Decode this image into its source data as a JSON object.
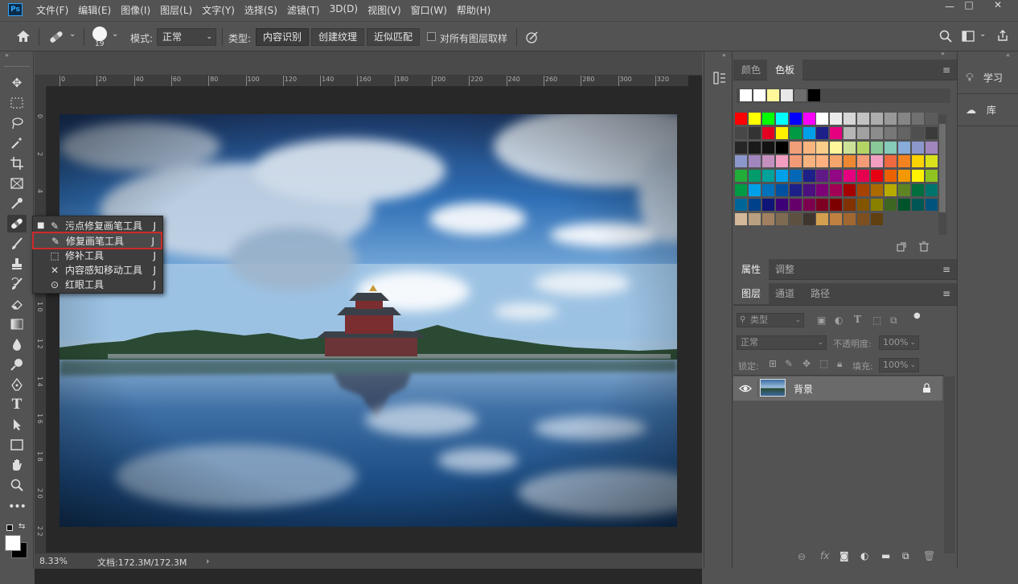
{
  "app": {
    "logo": "Ps"
  },
  "menu": [
    "文件(F)",
    "编辑(E)",
    "图像(I)",
    "图层(L)",
    "文字(Y)",
    "选择(S)",
    "滤镜(T)",
    "3D(D)",
    "视图(V)",
    "窗口(W)",
    "帮助(H)"
  ],
  "window_controls": {
    "minimize": "—",
    "maximize": "□",
    "close": "✕"
  },
  "options": {
    "brush_size": "19",
    "mode_label": "模式:",
    "mode_value": "正常",
    "type_label": "类型:",
    "type_buttons": [
      "内容识别",
      "创建纹理",
      "近似匹配"
    ],
    "sample_all": "对所有图层取样"
  },
  "ruler_top": [
    "0",
    "20",
    "40",
    "60",
    "80",
    "100",
    "120",
    "140",
    "160",
    "180",
    "200",
    "220",
    "240",
    "260",
    "280",
    "300",
    "320"
  ],
  "ruler_left": [
    "0",
    "2",
    "4",
    "6",
    "8",
    "1 0",
    "1 2",
    "1 4",
    "1 6",
    "1 8",
    "2 0",
    "2 2"
  ],
  "status": {
    "zoom": "8.33%",
    "doc": "文档:172.3M/172.3M",
    "arrow": "›"
  },
  "flyout": {
    "items": [
      {
        "label": "污点修复画笔工具",
        "key": "J",
        "icon": "spot-healing-brush-icon",
        "selected": true
      },
      {
        "label": "修复画笔工具",
        "key": "J",
        "icon": "healing-brush-icon",
        "highlighted": true
      },
      {
        "label": "修补工具",
        "key": "J",
        "icon": "patch-icon"
      },
      {
        "label": "内容感知移动工具",
        "key": "J",
        "icon": "content-aware-move-icon"
      },
      {
        "label": "红眼工具",
        "key": "J",
        "icon": "red-eye-icon"
      }
    ]
  },
  "color_panel": {
    "tabs": [
      "颜色",
      "色板"
    ],
    "active_tab": "色板",
    "recent": [
      "#ffffff",
      "#ffffff",
      "#fff799",
      "#e8e8e8",
      "#6e6e6e",
      "#000000"
    ],
    "rows": [
      [
        "#ff0000",
        "#ffff00",
        "#00ff00",
        "#00ffff",
        "#0000ff",
        "#ff00ff",
        "#ffffff",
        "#ebebeb",
        "#d6d6d6",
        "#c2c2c2",
        "#adadad",
        "#999999",
        "#858585",
        "#707070",
        "#5c5c5c"
      ],
      [
        "#474747",
        "#333333",
        "#e40020",
        "#fff100",
        "#009944",
        "#00a0e9",
        "#1d2088",
        "#e4007f",
        "#b5b5b5",
        "#a1a1a1",
        "#8c8c8c",
        "#787878",
        "#646464",
        "#4f4f4f",
        "#3b3b3b"
      ],
      [
        "#262626",
        "#1a1a1a",
        "#121212",
        "#000000",
        "#f19f79",
        "#f8b57f",
        "#facd89",
        "#fff799",
        "#cce198",
        "#b3d465",
        "#89c997",
        "#86caba",
        "#88abda",
        "#8c97cb",
        "#a186be"
      ],
      [
        "#8c97cb",
        "#a186be",
        "#c490bf",
        "#f19ec2",
        "#f29b76",
        "#f6b37f",
        "#ffb27f",
        "#f3a56c",
        "#ee8732",
        "#f29b76",
        "#f19ec2",
        "#ec6941",
        "#f58220",
        "#fcd200",
        "#d8e11a"
      ],
      [
        "#22ac38",
        "#009b6b",
        "#00a29a",
        "#00a0e9",
        "#0068b7",
        "#1d2088",
        "#601986",
        "#920783",
        "#e4007f",
        "#e5004f",
        "#e60012",
        "#eb6100",
        "#f39800",
        "#fff100",
        "#8fc31f"
      ],
      [
        "#009944",
        "#00a0e9",
        "#0072bc",
        "#0050a2",
        "#1d2088",
        "#4c0f7f",
        "#7d0077",
        "#a10054",
        "#a40000",
        "#a84200",
        "#ac6a00",
        "#b7aa00",
        "#5f8424",
        "#006e3e",
        "#00736d"
      ],
      [
        "#006699",
        "#00418b",
        "#0f1577",
        "#3e0077",
        "#65006b",
        "#7d004f",
        "#7d0022",
        "#7d0000",
        "#813200",
        "#825500",
        "#8a8000",
        "#3d6623",
        "#00542b",
        "#005653",
        "#00537c"
      ],
      [
        "#d3b89a",
        "#b8a080",
        "#a08060",
        "#7d6a50",
        "#5e5040",
        "#403630",
        "#d3a050",
        "#c08040",
        "#a06830",
        "#7d5020",
        "#604010"
      ]
    ]
  },
  "props_panel": {
    "tabs": [
      "属性",
      "调整"
    ]
  },
  "layers_panel": {
    "tabs": [
      "图层",
      "通道",
      "路径"
    ],
    "filter_placeholder": "类型",
    "blend_mode": "正常",
    "opacity_label": "不透明度:",
    "opacity_value": "100%",
    "lock_label": "锁定:",
    "fill_label": "填充:",
    "fill_value": "100%",
    "layer_name": "背景"
  },
  "right_panel": {
    "learn": "学习",
    "library": "库"
  },
  "colors": {
    "accent": "#31a8ff",
    "highlight": "#cf2a2a"
  }
}
